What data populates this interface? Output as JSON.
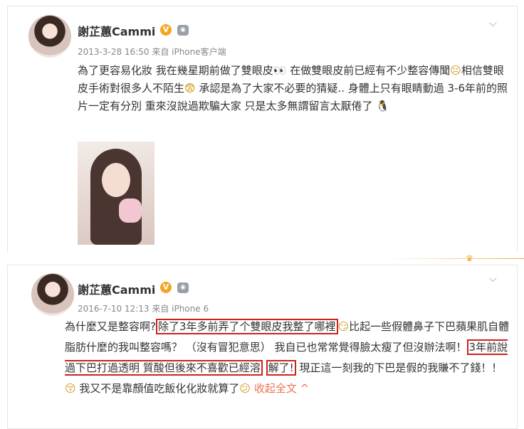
{
  "posts": [
    {
      "author": "謝芷蕙Cammi",
      "verified_icon": "verified-badge-icon",
      "robot_icon": "member-robot-icon",
      "meta": "2013-3-28 16:50 来自 iPhone客户端",
      "segments": [
        "為了更容易化妝 我在幾星期前做了雙眼皮",
        " 在做雙眼皮前已經有不少整容傳聞",
        "相信雙眼皮手術對很多人不陌生",
        " 承認是為了大家不必要的猜疑.. 身體上只有眼睛動過 3-6年前的照片一定有分別 重來沒說過欺騙大家 只是太多無謂留言太厭倦了"
      ],
      "emoji_1": "👀",
      "emoji_2": "☹",
      "emoji_3": "😨",
      "emoji_4": "🐧"
    },
    {
      "author": "謝芷蕙Cammi",
      "verified_icon": "verified-badge-icon",
      "robot_icon": "member-robot-icon",
      "meta": "2016-7-10 12:13 来自 iPhone 6",
      "segments": [
        "為什麼又是整容啊?",
        "除了3年多前弄了个雙眼皮我整了哪裡",
        "比起一些假體鼻子下巴蘋果肌自體脂肪什麼的我叫整容嗎？ （沒有冒犯意思） 我自已也常常覺得臉太瘦了但沒辦法啊！",
        "3年前說過下巴打過透明 質酸但後來不喜歡已經溶",
        "解了!",
        " 現正這一刻我的下巴是假的我賺不了錢！！",
        " 我又不是靠顏值吃飯化化妝就算了",
        " 收起全文 ^"
      ],
      "emoji_1": "😏",
      "emoji_2": "😚",
      "emoji_3": "😕"
    }
  ]
}
